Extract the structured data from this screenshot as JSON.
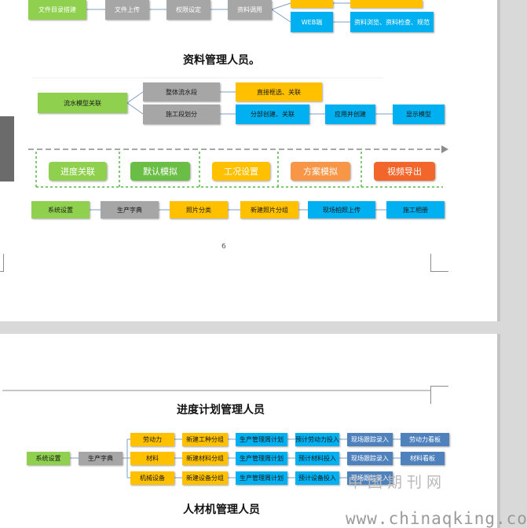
{
  "page1": {
    "flow_top": {
      "row1": [
        "文件目录搭建",
        "文件上传",
        "权限设定",
        "资料调用"
      ],
      "web_node": "WEB端",
      "web_actions": "资料浏览、资料检查、规范"
    },
    "caption1": "资料管理人员。",
    "flow_model": {
      "root": "流水模型关联",
      "branch1": "整体流水段",
      "branch1_action": "直接框选、关联",
      "branch2": "施工段划分",
      "branch2_actions": [
        "分部创建、关联",
        "应用并创建",
        "显示模型"
      ]
    },
    "progress_row": [
      "进度关联",
      "默认模拟",
      "工况设置",
      "方案模拟",
      "视频导出"
    ],
    "photo_row": [
      "系统设置",
      "生产字典",
      "照片分类",
      "新建照片分组",
      "现场拍照上传",
      "施工相册"
    ],
    "page_number": "6"
  },
  "page2": {
    "caption2": "进度计划管理人员",
    "flow_resources": {
      "start": [
        "系统设置",
        "生产字典"
      ],
      "rows": [
        [
          "劳动力",
          "新建工种分组",
          "生产管理周计划",
          "预计劳动力投入",
          "现场跟踪录入",
          "劳动力看板"
        ],
        [
          "材料",
          "新建材料分组",
          "生产管理周计划",
          "预计材料投入",
          "现场跟踪录入",
          "材料看板"
        ],
        [
          "机械设备",
          "新建设备分组",
          "生产管理周计划",
          "预计设备投入",
          "现场跟踪录入",
          ""
        ]
      ]
    },
    "caption3": "人材机管理人员"
  },
  "watermark": {
    "cn": "中国期刊网",
    "url": "www.chinaqking.com"
  }
}
